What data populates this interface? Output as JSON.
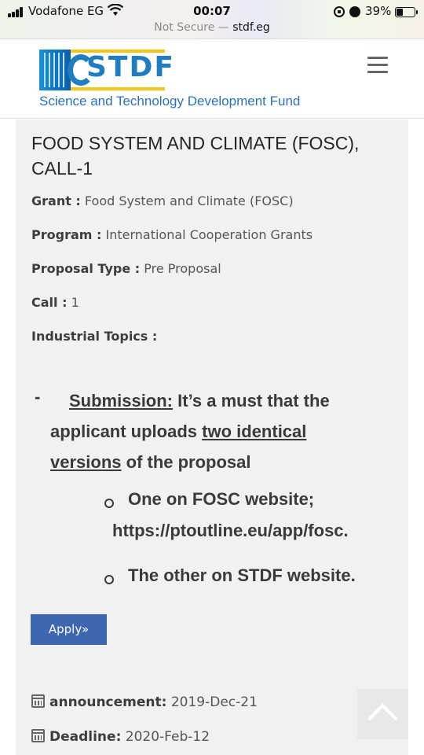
{
  "status_bar": {
    "carrier": "Vodafone EG",
    "time": "00:07",
    "battery_percent": "39%",
    "battery_level": 0.39
  },
  "url_bar": {
    "prefix": "Not Secure — ",
    "host": "stdf.eg"
  },
  "header": {
    "logo_text": "STDF",
    "logo_tagline": "Science and Technology Development Fund",
    "menu_icon": "hamburger-icon"
  },
  "call": {
    "title": "FOOD SYSTEM AND CLIMATE (FOSC), CALL-1",
    "fields": {
      "grant": {
        "label": "Grant :",
        "value": "Food System and Climate (FOSC)"
      },
      "program": {
        "label": "Program :",
        "value": "International Cooperation Grants"
      },
      "proposal_type": {
        "label": "Proposal Type :",
        "value": "Pre Proposal"
      },
      "call": {
        "label": "Call :",
        "value": "1"
      },
      "industrial_topics": {
        "label": "Industrial Topics :",
        "value": ""
      }
    },
    "notice": {
      "dash": "-",
      "submission_label": "Submission:",
      "text_before": "It’s a must that the applicant uploads",
      "underlined_phrase": "two identical versions",
      "text_after": "of the proposal",
      "item1_text": "One on FOSC website;",
      "item1_link": "https://ptoutline.eu/app/fosc.",
      "item2_text": "The other on STDF website."
    },
    "apply_label": "Apply»",
    "announcement": {
      "label": "announcement:",
      "value": "2019-Dec-21"
    },
    "deadline": {
      "label": "Deadline:",
      "value": "2020-Feb-12"
    }
  },
  "icons": {
    "calendar": "calendar-icon",
    "scroll_top": "chevron-up-icon"
  }
}
